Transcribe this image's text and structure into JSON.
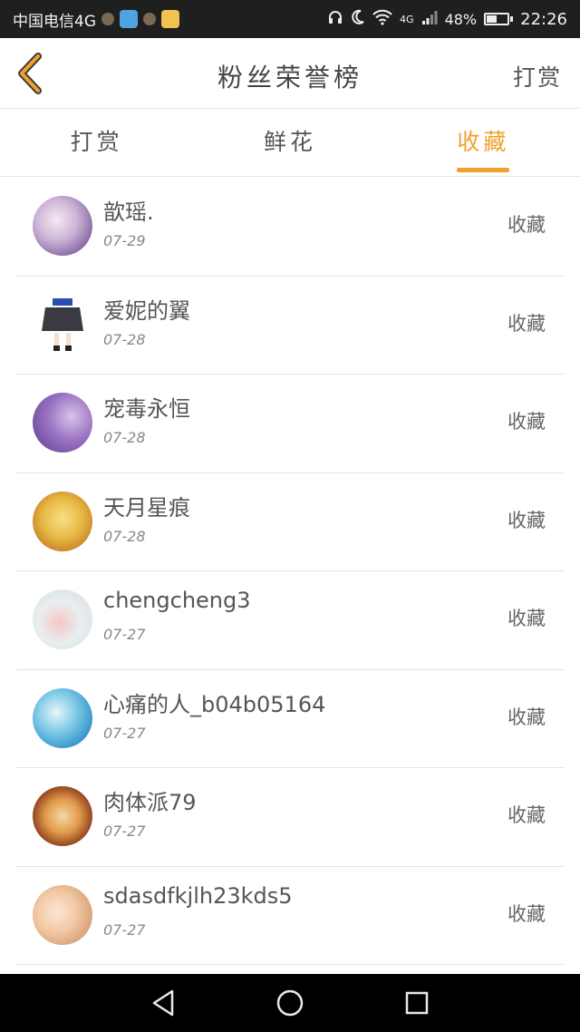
{
  "status_bar": {
    "carrier": "中国电信4G",
    "net_label": "4G",
    "battery_percent": "48%",
    "battery_level": 0.48,
    "time": "22:26"
  },
  "header": {
    "title": "粉丝荣誉榜",
    "action_label": "打赏"
  },
  "tabs": [
    {
      "label": "打赏",
      "active": false
    },
    {
      "label": "鲜花",
      "active": false
    },
    {
      "label": "收藏",
      "active": true
    }
  ],
  "accent_color": "#f0a22a",
  "rows": [
    {
      "name": "歆瑶.",
      "date": "07-29",
      "type": "收藏"
    },
    {
      "name": "爱妮的翼",
      "date": "07-28",
      "type": "收藏"
    },
    {
      "name": "宠毒永恒",
      "date": "07-28",
      "type": "收藏"
    },
    {
      "name": "天月星痕",
      "date": "07-28",
      "type": "收藏"
    },
    {
      "name": "chengcheng3",
      "date": "07-27",
      "type": "收藏"
    },
    {
      "name": "心痛的人_b04b05164",
      "date": "07-27",
      "type": "收藏"
    },
    {
      "name": "肉体派79",
      "date": "07-27",
      "type": "收藏"
    },
    {
      "name": "sdasdfkjlh23kds5",
      "date": "07-27",
      "type": "收藏"
    }
  ],
  "nav": {
    "back_icon": "triangle-back-icon",
    "home_icon": "circle-home-icon",
    "recents_icon": "square-recents-icon"
  }
}
